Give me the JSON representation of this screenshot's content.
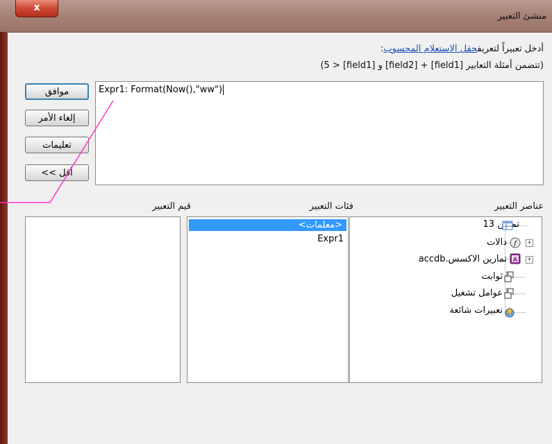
{
  "window": {
    "title": "منشئ التعبير",
    "close_label": "x"
  },
  "instructions": {
    "line1_prefix": "أدخل تعبيراً لتعريف",
    "line1_link": "حقل الاستعلام المحسوب",
    "line1_suffix": ":",
    "line2": "(تتضمن أمثلة التعابير [field1] + [field2] و [field1] < 5)"
  },
  "expression": {
    "value": "Expr1: Format(Now(),\"ww\")"
  },
  "buttons": {
    "ok": "موافق",
    "cancel": "إلغاء الأمر",
    "help": "تعليمات",
    "less": "<< أقل"
  },
  "sections": {
    "elements_label": "عناصر التعبير",
    "categories_label": "فئات التعبير",
    "values_label": "قيم التعبير"
  },
  "elements_tree": [
    {
      "label": "تمرين 13",
      "icon": "query-icon"
    },
    {
      "label": "دالات",
      "icon": "functions-icon"
    },
    {
      "label": "تمارين الاكسس.accdb",
      "icon": "database-icon"
    },
    {
      "label": "ثوابت",
      "icon": "constants-icon"
    },
    {
      "label": "عوامل تشغيل",
      "icon": "operators-icon"
    },
    {
      "label": "تعبيرات شائعة",
      "icon": "common-expressions-icon"
    }
  ],
  "categories": {
    "selected": "<معلمات>",
    "items": [
      "Expr1"
    ]
  },
  "values": [],
  "colors": {
    "selection": "#3399ff",
    "link": "#1a4fb8",
    "annotation_line": "#ff33cc"
  }
}
